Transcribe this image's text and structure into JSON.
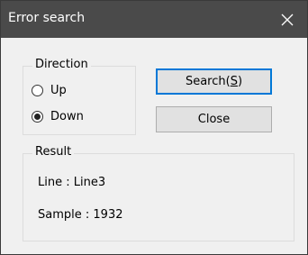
{
  "window": {
    "title": "Error search"
  },
  "direction": {
    "legend": "Direction",
    "options": [
      {
        "label": "Up",
        "selected": false
      },
      {
        "label": "Down",
        "selected": true
      }
    ]
  },
  "buttons": {
    "search": {
      "label_prefix": "Search(",
      "mnemonic": "S",
      "label_suffix": ")"
    },
    "close": {
      "label": "Close"
    }
  },
  "result": {
    "legend": "Result",
    "line_label": "Line",
    "line_value": "Line3",
    "sample_label": "Sample",
    "sample_value": "1932"
  },
  "colors": {
    "titlebar": "#4a4a4a",
    "accent": "#0078d7",
    "dialog_bg": "#f0f0f0"
  }
}
